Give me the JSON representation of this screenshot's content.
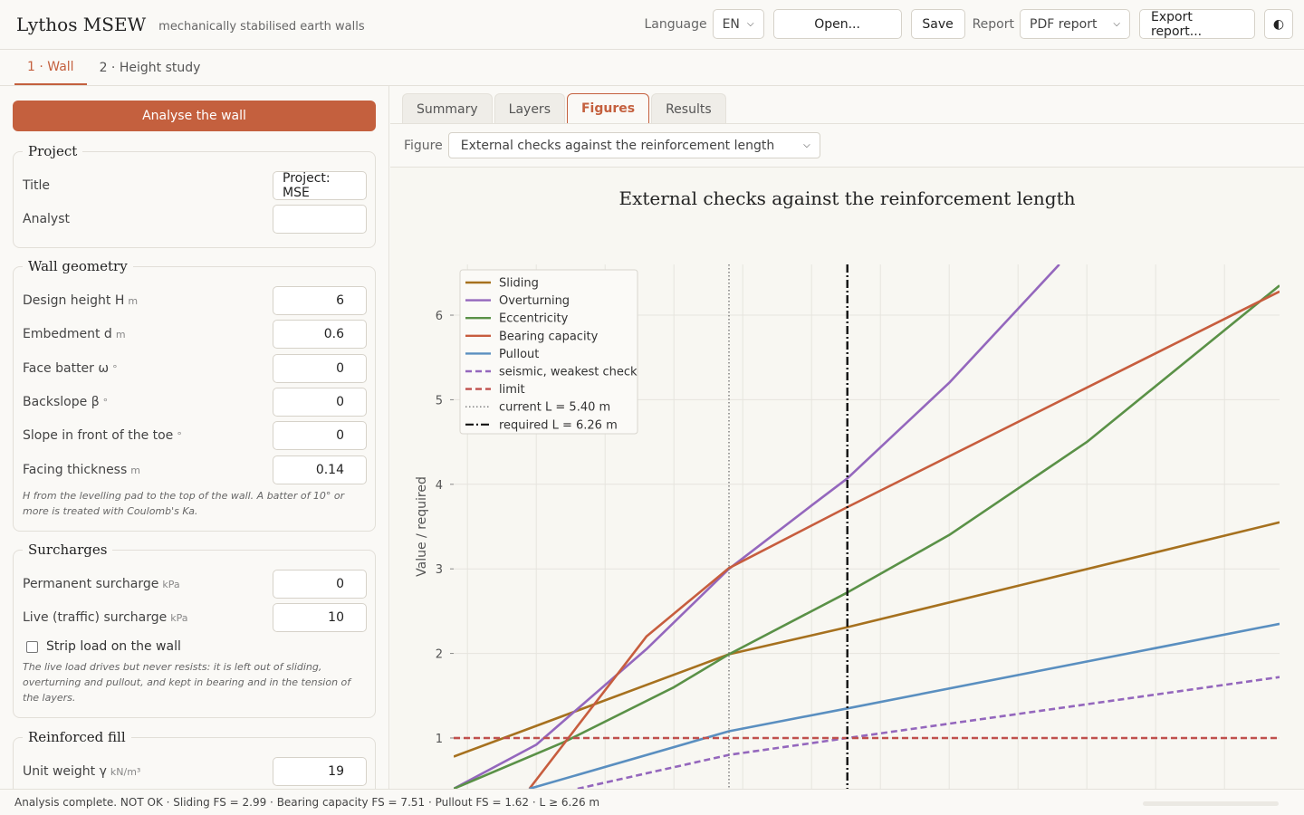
{
  "header": {
    "title": "Lythos MSEW",
    "subtitle": "mechanically stabilised earth walls",
    "language_label": "Language",
    "language_value": "EN",
    "open_label": "Open...",
    "save_label": "Save",
    "report_label": "Report",
    "report_value": "PDF report",
    "export_label": "Export report...",
    "theme_icon": "◐"
  },
  "top_tabs": [
    {
      "label": "1 · Wall"
    },
    {
      "label": "2 · Height study"
    }
  ],
  "sidebar": {
    "analyse_label": "Analyse the wall",
    "project": {
      "legend": "Project",
      "title_label": "Title",
      "title_value": "Project: MSE",
      "analyst_label": "Analyst",
      "analyst_value": ""
    },
    "geometry": {
      "legend": "Wall geometry",
      "fields": [
        {
          "label": "Design height H",
          "unit": "m",
          "value": "6"
        },
        {
          "label": "Embedment d",
          "unit": "m",
          "value": "0.6"
        },
        {
          "label": "Face batter ω",
          "unit": "°",
          "value": "0"
        },
        {
          "label": "Backslope β",
          "unit": "°",
          "value": "0"
        },
        {
          "label": "Slope in front of the toe",
          "unit": "°",
          "value": "0"
        },
        {
          "label": "Facing thickness",
          "unit": "m",
          "value": "0.14"
        }
      ],
      "note": "H from the levelling pad to the top of the wall. A batter of 10° or more is treated with Coulomb's Ka."
    },
    "surcharges": {
      "legend": "Surcharges",
      "fields": [
        {
          "label": "Permanent surcharge",
          "unit": "kPa",
          "value": "0"
        },
        {
          "label": "Live (traffic) surcharge",
          "unit": "kPa",
          "value": "10"
        }
      ],
      "strip_label": "Strip load on the wall",
      "note": "The live load drives but never resists: it is left out of sliding, overturning and pullout, and kept in bearing and in the tension of the layers."
    },
    "fill": {
      "legend": "Reinforced fill",
      "fields": [
        {
          "label": "Unit weight γ",
          "unit": "kN/m³",
          "value": "19"
        }
      ]
    }
  },
  "main": {
    "tabs": [
      {
        "label": "Summary"
      },
      {
        "label": "Layers"
      },
      {
        "label": "Figures"
      },
      {
        "label": "Results"
      }
    ],
    "figure_label": "Figure",
    "figure_value": "External checks against the reinforcement length"
  },
  "chart_data": {
    "type": "line",
    "title": "External checks against the reinforcement length",
    "xlabel": "",
    "ylabel": "Value / required",
    "xlim": [
      3.4,
      9.4
    ],
    "ylim": [
      0.4,
      6.6
    ],
    "yticks": [
      1,
      2,
      3,
      4,
      5,
      6
    ],
    "grid": true,
    "legend_position": "top-left",
    "series": [
      {
        "name": "Sliding",
        "color": "#a6711f",
        "style": "solid",
        "x": [
          3.4,
          5.4,
          6.26,
          9.4
        ],
        "y": [
          0.78,
          1.99,
          2.31,
          3.55
        ]
      },
      {
        "name": "Overturning",
        "color": "#9467bd",
        "style": "solid",
        "x": [
          3.4,
          4.0,
          4.8,
          5.4,
          6.0,
          6.26,
          7.0,
          7.8
        ],
        "y": [
          0.4,
          0.92,
          2.05,
          3.0,
          3.75,
          4.07,
          5.2,
          6.6
        ]
      },
      {
        "name": "Eccentricity",
        "color": "#5a9147",
        "style": "solid",
        "x": [
          3.4,
          4.2,
          5.0,
          5.4,
          6.26,
          7.0,
          8.0,
          9.4
        ],
        "y": [
          0.4,
          0.95,
          1.6,
          1.99,
          2.72,
          3.4,
          4.5,
          6.35
        ]
      },
      {
        "name": "Bearing capacity",
        "color": "#c75d3e",
        "style": "solid",
        "x": [
          3.95,
          4.8,
          5.4,
          6.26,
          9.4
        ],
        "y": [
          0.4,
          2.2,
          3.01,
          3.73,
          6.28
        ]
      },
      {
        "name": "Pullout",
        "color": "#5a8fc0",
        "style": "solid",
        "x": [
          3.95,
          5.4,
          6.26,
          9.4
        ],
        "y": [
          0.4,
          1.08,
          1.35,
          2.35
        ]
      },
      {
        "name": "seismic, weakest check",
        "color": "#9467bd",
        "style": "dashed",
        "x": [
          4.3,
          5.4,
          6.26,
          9.4
        ],
        "y": [
          0.4,
          0.8,
          1.0,
          1.72
        ]
      },
      {
        "name": "limit",
        "color": "#c0504d",
        "style": "dashed",
        "x": [
          3.4,
          9.4
        ],
        "y": [
          1.0,
          1.0
        ]
      }
    ],
    "vlines": [
      {
        "name": "current L = 5.40 m",
        "x": 5.4,
        "color": "#777777",
        "style": "dotted"
      },
      {
        "name": "required L = 6.26 m",
        "x": 6.26,
        "color": "#111111",
        "style": "dashdot"
      }
    ]
  },
  "status": {
    "text": "Analysis complete. NOT OK · Sliding FS = 2.99 · Bearing capacity FS = 7.51 · Pullout FS = 1.62 · L ≥ 6.26 m"
  }
}
